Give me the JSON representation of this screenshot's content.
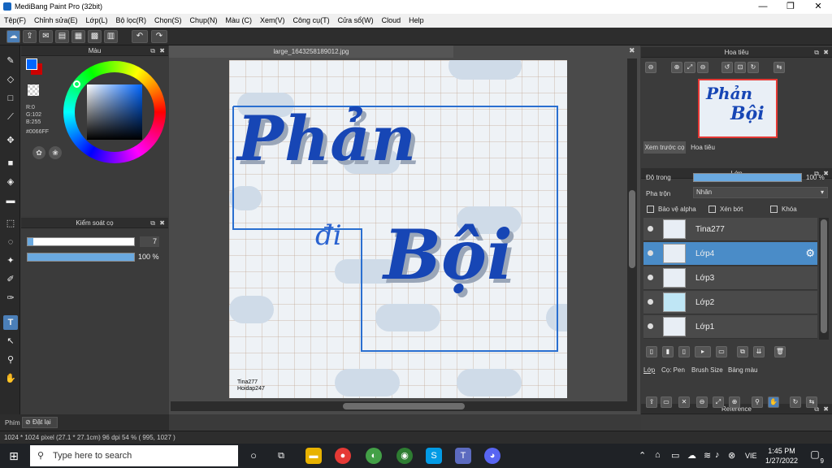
{
  "window": {
    "title": "MediBang Paint Pro (32bit)",
    "min": "—",
    "max": "❐",
    "close": "✕"
  },
  "menu": [
    "Tệp(F)",
    "Chỉnh sửa(E)",
    "Lớp(L)",
    "Bộ lọc(R)",
    "Chọn(S)",
    "Chụp(N)",
    "Màu (C)",
    "Xem(V)",
    "Công cụ(T)",
    "Cửa sổ(W)",
    "Cloud",
    "Help"
  ],
  "color_panel": {
    "title": "Màu",
    "r": "R:0",
    "g": "G:102",
    "b": "B:255",
    "hex": "#0066FF",
    "fg": "#0066FF",
    "bg": "#cc0000"
  },
  "brush_panel": {
    "title": "Kiểm soát cọ",
    "size": "7",
    "opacity": "100 %",
    "size_frac": 0.05,
    "opacity_frac": 1.0
  },
  "canvas": {
    "tab": "large_1643258189012.jpg",
    "art_line1": "Phản",
    "art_line2": "Bội",
    "art_small": "đi",
    "sig1": "Tina277",
    "sig2": "Hoidap247"
  },
  "navigator": {
    "title": "Hoa tiêu",
    "tab1": "Xem trước cọ",
    "tab2": "Hoa tiêu"
  },
  "layers": {
    "title": "Lớp",
    "opacity_label": "Độ trong",
    "opacity_value": "100 %",
    "blend_label": "Pha trộn",
    "blend_value": "Nhân",
    "alpha": "Bảo vệ alpha",
    "clip": "Xén bớt",
    "lock": "Khóa",
    "items": [
      {
        "name": "Tina277",
        "selected": false
      },
      {
        "name": "Lớp4",
        "selected": true
      },
      {
        "name": "Lớp3",
        "selected": false
      },
      {
        "name": "Lớp2",
        "selected": false
      },
      {
        "name": "Lớp1",
        "selected": false
      }
    ],
    "tabs": [
      "Lớp",
      "Cọ: Pen",
      "Brush Size",
      "Bảng màu"
    ]
  },
  "reference": {
    "title": "Reference"
  },
  "bottom": {
    "phim": "Phím",
    "reset": "Đặt lại"
  },
  "status": {
    "text": "1024 * 1024 pixel   (27.1 * 27.1cm)   96 dpi   54 %   ( 995, 1027 )"
  },
  "taskbar": {
    "search": "Type here to search",
    "time": "1:45 PM",
    "date": "1/27/2022",
    "lang": "VIE",
    "notif": "9"
  }
}
